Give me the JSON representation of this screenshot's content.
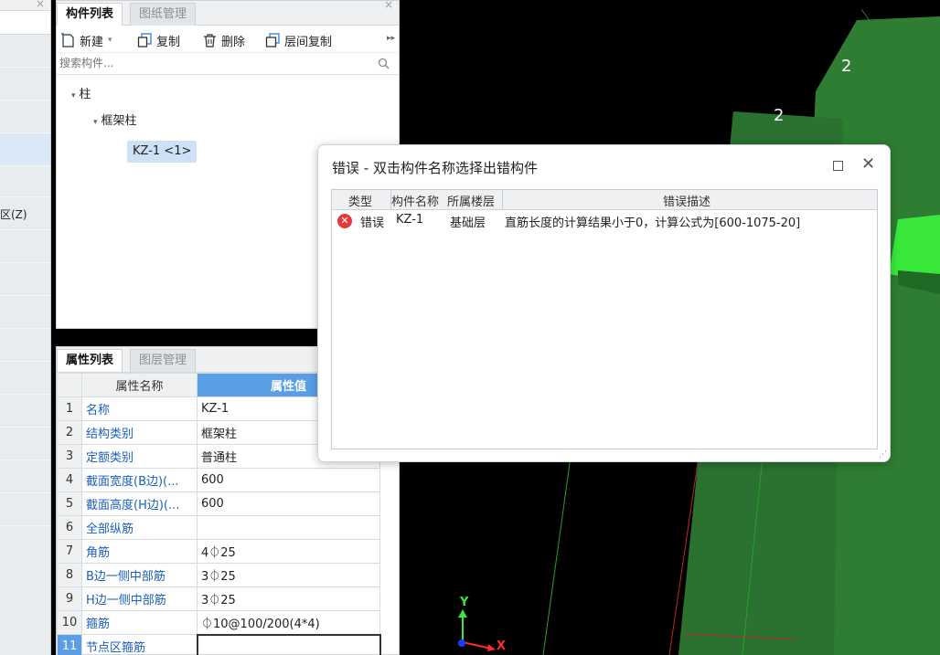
{
  "left_panel": {
    "close_glyph": "×",
    "partial_label": "区(Z)"
  },
  "component_panel": {
    "tabs": [
      "构件列表",
      "图纸管理"
    ],
    "close_glyph": "×",
    "toolbar": {
      "new_label": "新建",
      "copy_label": "复制",
      "delete_label": "删除",
      "floor_copy_label": "层间复制",
      "more_glyph": "▸▸"
    },
    "search_placeholder": "搜索构件...",
    "tree": {
      "root": "柱",
      "child": "框架柱",
      "leaf": "KZ-1 <1>"
    }
  },
  "property_panel": {
    "tabs": [
      "属性列表",
      "图层管理"
    ],
    "col_name": "属性名称",
    "col_value": "属性值",
    "rows": [
      {
        "num": "1",
        "name": "名称",
        "value": "KZ-1"
      },
      {
        "num": "2",
        "name": "结构类别",
        "value": "框架柱"
      },
      {
        "num": "3",
        "name": "定额类别",
        "value": "普通柱"
      },
      {
        "num": "4",
        "name": "截面宽度(B边)(...",
        "value": "600"
      },
      {
        "num": "5",
        "name": "截面高度(H边)(...",
        "value": "600"
      },
      {
        "num": "6",
        "name": "全部纵筋",
        "value": ""
      },
      {
        "num": "7",
        "name": "角筋",
        "value": "4⏀25"
      },
      {
        "num": "8",
        "name": "B边一侧中部筋",
        "value": "3⏀25"
      },
      {
        "num": "9",
        "name": "H边一侧中部筋",
        "value": "3⏀25"
      },
      {
        "num": "10",
        "name": "箍筋",
        "value": "⏀10@100/200(4*4)"
      },
      {
        "num": "11",
        "name": "节点区箍筋",
        "value": ""
      }
    ]
  },
  "viewport": {
    "label_a": "2",
    "label_b": "2",
    "axis_y": "Y",
    "axis_x": "X"
  },
  "error_dialog": {
    "title": "错误 - 双击构件名称选择出错构件",
    "max_glyph": "",
    "close_glyph": "✕",
    "columns": [
      "类型",
      "构件名称",
      "所属楼层",
      "错误描述"
    ],
    "rows": [
      {
        "icon": "✕",
        "type": "错误",
        "component": "KZ-1",
        "floor": "基础层",
        "description": "直筋长度的计算结果小于0，计算公式为[600-1075-20]"
      }
    ],
    "grip_glyph": "⋰"
  },
  "colors": {
    "accent_blue": "#5a9fe6",
    "selection_blue": "#cde0f6",
    "error_red": "#e23b3b",
    "model_green": "#2e7d32",
    "bright_green": "#39e83a"
  }
}
